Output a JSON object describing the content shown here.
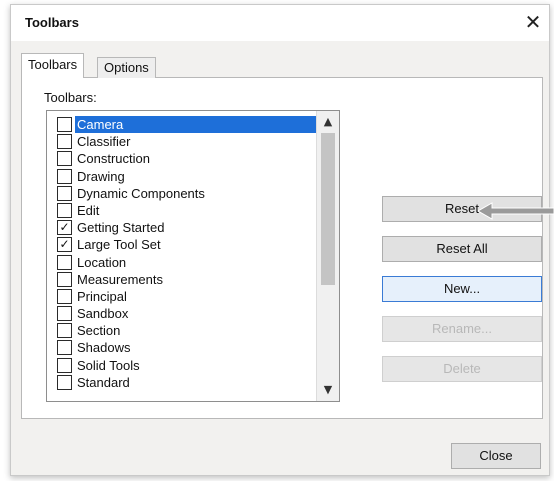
{
  "window": {
    "title": "Toolbars",
    "close_glyph": "✕"
  },
  "tabs": [
    {
      "label": "Toolbars",
      "active": true
    },
    {
      "label": "Options",
      "active": false
    }
  ],
  "list": {
    "label": "Toolbars:",
    "items": [
      {
        "label": "Camera",
        "checked": false,
        "selected": true
      },
      {
        "label": "Classifier",
        "checked": false,
        "selected": false
      },
      {
        "label": "Construction",
        "checked": false,
        "selected": false
      },
      {
        "label": "Drawing",
        "checked": false,
        "selected": false
      },
      {
        "label": "Dynamic Components",
        "checked": false,
        "selected": false
      },
      {
        "label": "Edit",
        "checked": false,
        "selected": false
      },
      {
        "label": "Getting Started",
        "checked": true,
        "selected": false
      },
      {
        "label": "Large Tool Set",
        "checked": true,
        "selected": false
      },
      {
        "label": "Location",
        "checked": false,
        "selected": false
      },
      {
        "label": "Measurements",
        "checked": false,
        "selected": false
      },
      {
        "label": "Principal",
        "checked": false,
        "selected": false
      },
      {
        "label": "Sandbox",
        "checked": false,
        "selected": false
      },
      {
        "label": "Section",
        "checked": false,
        "selected": false
      },
      {
        "label": "Shadows",
        "checked": false,
        "selected": false
      },
      {
        "label": "Solid Tools",
        "checked": false,
        "selected": false
      },
      {
        "label": "Standard",
        "checked": false,
        "selected": false
      }
    ],
    "check_glyph": "✓",
    "scroll_up_glyph": "▲",
    "scroll_down_glyph": "▼"
  },
  "buttons": {
    "reset": "Reset",
    "reset_all": "Reset All",
    "new": "New...",
    "rename": "Rename...",
    "delete": "Delete",
    "close": "Close"
  },
  "colors": {
    "selection": "#1e6fd9",
    "arrow_pointer": "#9a9a9a"
  }
}
